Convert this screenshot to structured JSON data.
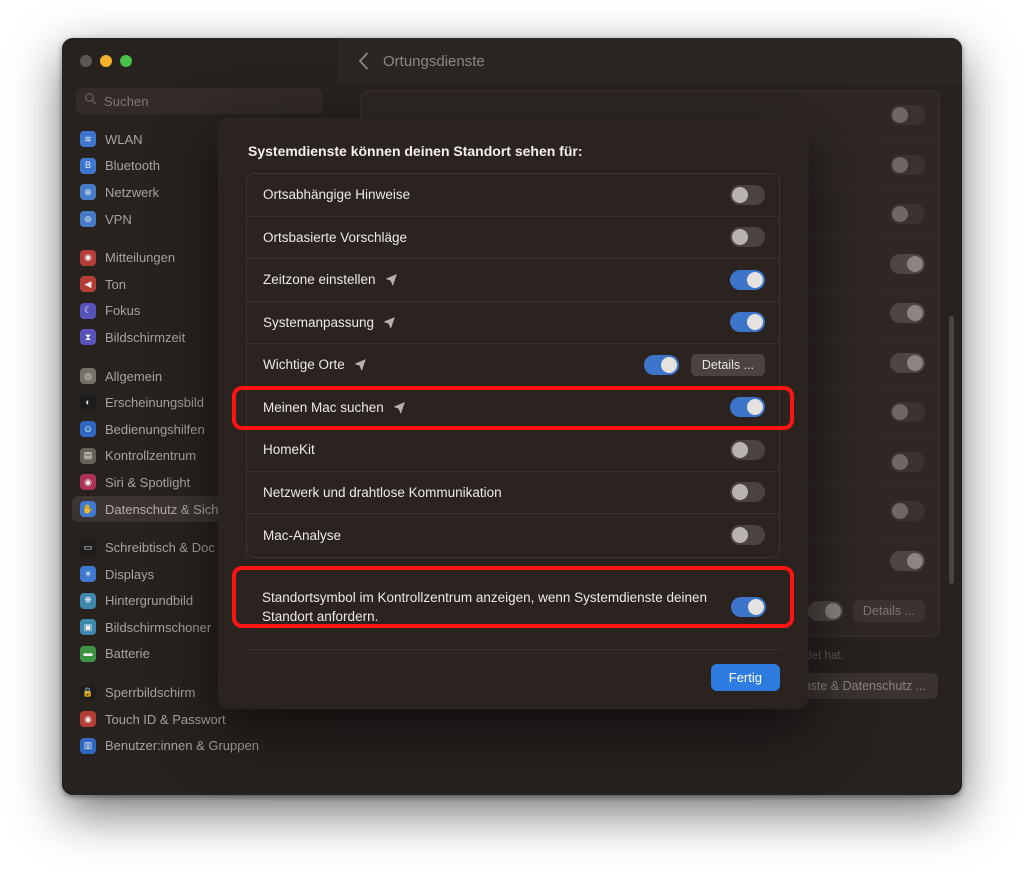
{
  "window": {
    "traffic_lights": [
      "close",
      "minimize",
      "maximize"
    ],
    "toolbar": {
      "back_icon": "chevron-left-icon",
      "title": "Ortungsdienste"
    }
  },
  "sidebar": {
    "search": {
      "placeholder": "Suchen",
      "value": "",
      "icon": "search-icon"
    },
    "groups": [
      {
        "items": [
          {
            "label": "WLAN",
            "icon": "wifi-icon",
            "color": "#3f7fe0",
            "selected": false
          },
          {
            "label": "Bluetooth",
            "icon": "bluetooth-icon",
            "color": "#3f7fe0",
            "selected": false
          },
          {
            "label": "Netzwerk",
            "icon": "globe-icon",
            "color": "#4a82d8",
            "selected": false
          },
          {
            "label": "VPN",
            "icon": "vpn-icon",
            "color": "#4a82d8",
            "selected": false
          }
        ]
      },
      {
        "items": [
          {
            "label": "Mitteilungen",
            "icon": "bell-icon",
            "color": "#c0403a",
            "selected": false
          },
          {
            "label": "Ton",
            "icon": "speaker-icon",
            "color": "#c0403a",
            "selected": false
          },
          {
            "label": "Fokus",
            "icon": "moon-icon",
            "color": "#5d57c9",
            "selected": false
          },
          {
            "label": "Bildschirmzeit",
            "icon": "hourglass-icon",
            "color": "#5d57c9",
            "selected": false
          }
        ]
      },
      {
        "items": [
          {
            "label": "Allgemein",
            "icon": "gear-icon",
            "color": "#7d7772",
            "selected": false
          },
          {
            "label": "Erscheinungsbild",
            "icon": "contrast-icon",
            "color": "#1c1c1c",
            "selected": false
          },
          {
            "label": "Bedienungshilfen",
            "icon": "accessibility-icon",
            "color": "#2f6fd0",
            "selected": false
          },
          {
            "label": "Kontrollzentrum",
            "icon": "sliders-icon",
            "color": "#6e6863",
            "selected": false
          },
          {
            "label": "Siri & Spotlight",
            "icon": "siri-icon",
            "color": "#b8345c",
            "selected": false
          },
          {
            "label": "Datenschutz & Sich",
            "icon": "hand-shield-icon",
            "color": "#3f7fe0",
            "selected": true
          }
        ]
      },
      {
        "items": [
          {
            "label": "Schreibtisch & Doc",
            "icon": "desktop-dock-icon",
            "color": "#1d1d1d",
            "selected": false
          },
          {
            "label": "Displays",
            "icon": "display-icon",
            "color": "#3f7fe0",
            "selected": false
          },
          {
            "label": "Hintergrundbild",
            "icon": "wallpaper-icon",
            "color": "#3f8fb8",
            "selected": false
          },
          {
            "label": "Bildschirmschoner",
            "icon": "screensaver-icon",
            "color": "#3f8fb8",
            "selected": false
          },
          {
            "label": "Batterie",
            "icon": "battery-icon",
            "color": "#3f9e48",
            "selected": false
          }
        ]
      },
      {
        "items": [
          {
            "label": "Sperrbildschirm",
            "icon": "lock-icon",
            "color": "#1d1d1d",
            "selected": false
          },
          {
            "label": "Touch ID & Passwort",
            "icon": "touchid-icon",
            "color": "#c0403a",
            "selected": false
          },
          {
            "label": "Benutzer:innen & Gruppen",
            "icon": "users-icon",
            "color": "#2f6fd0",
            "selected": false
          }
        ]
      }
    ]
  },
  "background_panel": {
    "toggle_states": [
      "off",
      "off",
      "off",
      "on",
      "on",
      "on",
      "off",
      "off",
      "off",
      "on",
      "on"
    ],
    "details_button": "Details ...",
    "footnote": {
      "icon": "location-arrow-icon",
      "text": "Zeigt an, dass eine App deinen Standort innerhalb der letzten 24 Stunden verwendet hat."
    },
    "about_button": "Über Ortungsdienste & Datenschutz ..."
  },
  "sheet": {
    "title": "Systemdienste können deinen Standort sehen für:",
    "services": [
      {
        "label": "Ortsabhängige Hinweise",
        "arrow": false,
        "toggle": "off",
        "details": null,
        "highlighted": false
      },
      {
        "label": "Ortsbasierte Vorschläge",
        "arrow": false,
        "toggle": "off",
        "details": null,
        "highlighted": false
      },
      {
        "label": "Zeitzone einstellen",
        "arrow": true,
        "toggle": "on",
        "details": null,
        "highlighted": false
      },
      {
        "label": "Systemanpassung",
        "arrow": true,
        "toggle": "on",
        "details": null,
        "highlighted": false
      },
      {
        "label": "Wichtige Orte",
        "arrow": true,
        "toggle": "on",
        "details": "Details ...",
        "highlighted": false
      },
      {
        "label": "Meinen Mac suchen",
        "arrow": true,
        "toggle": "on",
        "details": null,
        "highlighted": true
      },
      {
        "label": "HomeKit",
        "arrow": false,
        "toggle": "off",
        "details": null,
        "highlighted": false
      },
      {
        "label": "Netzwerk und drahtlose Kommunikation",
        "arrow": false,
        "toggle": "off",
        "details": null,
        "highlighted": false
      },
      {
        "label": "Mac-Analyse",
        "arrow": false,
        "toggle": "off",
        "details": null,
        "highlighted": false
      }
    ],
    "control_center_row": {
      "text": "Standortsymbol im Kontrollzentrum anzeigen, wenn Systemdienste deinen Standort anfordern.",
      "toggle": "on",
      "highlighted": true
    },
    "done_button": "Fertig"
  },
  "colors": {
    "accent_blue": "#2f7ce0",
    "toggle_on": "#3c75c9",
    "highlight_red": "#ff1414",
    "window_bg": "#272220",
    "sidebar_bg": "#28221f",
    "sheet_bg": "#2a2320"
  }
}
